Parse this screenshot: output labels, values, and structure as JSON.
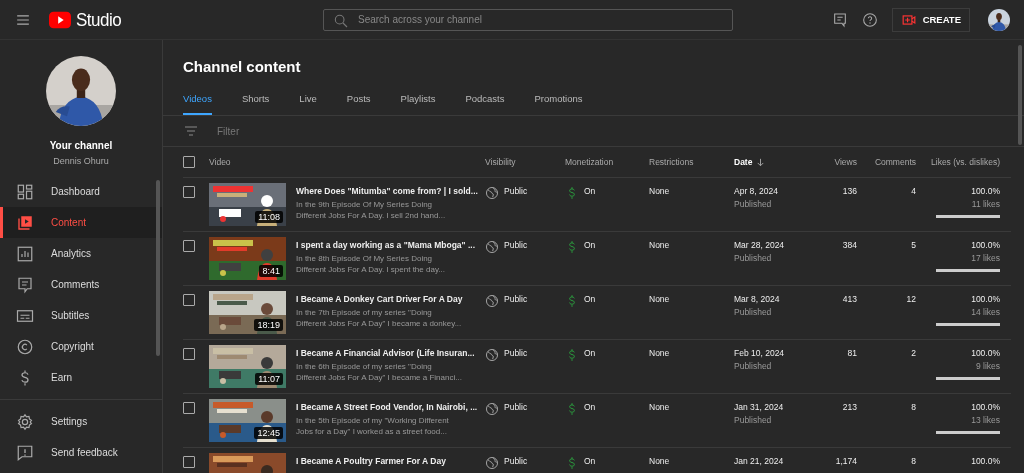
{
  "header": {
    "logo_text": "Studio",
    "search": {
      "placeholder": "Search across your channel"
    },
    "create_button": "CREATE"
  },
  "sidebar": {
    "channel_label": "Your channel",
    "channel_name": "Dennis Ohuru",
    "items": [
      {
        "kind": "dashboard",
        "label": "Dashboard",
        "selected": false
      },
      {
        "kind": "content",
        "label": "Content",
        "selected": true
      },
      {
        "kind": "analytics",
        "label": "Analytics",
        "selected": false
      },
      {
        "kind": "comments",
        "label": "Comments",
        "selected": false
      },
      {
        "kind": "subtitles",
        "label": "Subtitles",
        "selected": false
      },
      {
        "kind": "copyright",
        "label": "Copyright",
        "selected": false
      },
      {
        "kind": "earn",
        "label": "Earn",
        "selected": false
      }
    ],
    "footer_items": [
      {
        "kind": "settings",
        "label": "Settings"
      },
      {
        "kind": "feedback",
        "label": "Send feedback"
      }
    ]
  },
  "page_title": "Channel content",
  "tabs": [
    {
      "label": "Videos",
      "selected": true
    },
    {
      "label": "Shorts",
      "selected": false
    },
    {
      "label": "Live",
      "selected": false
    },
    {
      "label": "Posts",
      "selected": false
    },
    {
      "label": "Playlists",
      "selected": false
    },
    {
      "label": "Podcasts",
      "selected": false
    },
    {
      "label": "Promotions",
      "selected": false
    }
  ],
  "filter": {
    "placeholder": "Filter"
  },
  "table": {
    "select_all_checked": false,
    "columns": [
      {
        "label": "Video",
        "sorted": false
      },
      {
        "label": "Visibility",
        "sorted": false
      },
      {
        "label": "Monetization",
        "sorted": false
      },
      {
        "label": "Restrictions",
        "sorted": false
      },
      {
        "label": "Date",
        "sorted": true
      },
      {
        "label": "Views",
        "sorted": false
      },
      {
        "label": "Comments",
        "sorted": false
      },
      {
        "label": "Likes (vs. dislikes)",
        "sorted": false
      }
    ],
    "rows": [
      {
        "checked": false,
        "duration": "11:08",
        "title": "Where Does \"Mitumba\" come from? | I sold...",
        "description": "In the 9th Episode Of My Series Doing Different Jobs For A Day. I sell 2nd hand...",
        "visibility": "Public",
        "monetization": "On",
        "restrictions": "None",
        "date": "Apr 8, 2024",
        "status": "Published",
        "views": "136",
        "comments": "4",
        "likes_percent": "100.0%",
        "likes": "11 likes",
        "level": 1
      },
      {
        "checked": false,
        "duration": "8:41",
        "title": "I spent a day working as a \"Mama Mboga\" ...",
        "description": "In the 8th Episode Of My Series Doing Different Jobs For A Day. I spent the day...",
        "visibility": "Public",
        "monetization": "On",
        "restrictions": "None",
        "date": "Mar 28, 2024",
        "status": "Published",
        "views": "384",
        "comments": "5",
        "likes_percent": "100.0%",
        "likes": "17 likes",
        "level": 1
      },
      {
        "checked": false,
        "duration": "18:19",
        "title": "I Became A Donkey Cart Driver For A Day",
        "description": "In the 7th Episode of my series \"Doing Different Jobs For A Day\" I became a donkey...",
        "visibility": "Public",
        "monetization": "On",
        "restrictions": "None",
        "date": "Mar 8, 2024",
        "status": "Published",
        "views": "413",
        "comments": "12",
        "likes_percent": "100.0%",
        "likes": "14 likes",
        "level": 1
      },
      {
        "checked": false,
        "duration": "11:07",
        "title": "I Became A Financial Advisor (Life Insuran...",
        "description": "In the 6th Episode of my series \"Doing Different Jobs For A Day\" I became a Financi...",
        "visibility": "Public",
        "monetization": "On",
        "restrictions": "None",
        "date": "Feb 10, 2024",
        "status": "Published",
        "views": "81",
        "comments": "2",
        "likes_percent": "100.0%",
        "likes": "9 likes",
        "level": 1
      },
      {
        "checked": false,
        "duration": "12:45",
        "title": "I Became A Street Food Vendor, In Nairobi, ...",
        "description": "In the 5th Episode of my \"Working Different Jobs for a Day\" I worked as a street food...",
        "visibility": "Public",
        "monetization": "On",
        "restrictions": "None",
        "date": "Jan 31, 2024",
        "status": "Published",
        "views": "213",
        "comments": "8",
        "likes_percent": "100.0%",
        "likes": "13 likes",
        "level": 1
      },
      {
        "checked": false,
        "title": "I Became A Poultry Farmer For A Day",
        "visibility": "Public",
        "monetization": "On",
        "restrictions": "None",
        "date": "Jan 21, 2024",
        "views": "1,174",
        "comments": "8",
        "likes_percent": "100.0%"
      }
    ]
  }
}
